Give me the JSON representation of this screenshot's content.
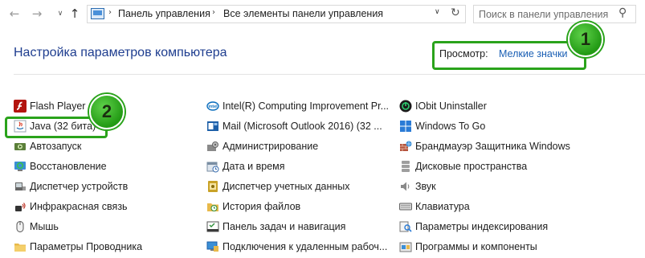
{
  "nav": {
    "back_icon": "arrow-left-icon",
    "forward_icon": "arrow-right-icon",
    "recent_icon": "chevron-down-icon",
    "up_icon": "arrow-up-icon"
  },
  "address": {
    "crumbs": [
      "Панель управления",
      "Все элементы панели управления"
    ],
    "separator": "›",
    "dropdown_glyph": "∨",
    "refresh_glyph": "↻"
  },
  "search": {
    "placeholder": "Поиск в панели управления"
  },
  "header": {
    "title": "Настройка параметров компьютера",
    "view_label": "Просмотр:",
    "view_value": "Мелкие значки"
  },
  "callouts": {
    "first": "1",
    "second": "2"
  },
  "columns": [
    [
      {
        "label": "Flash Player (3",
        "icon": "flash-icon"
      },
      {
        "label": "Java (32 бита)",
        "icon": "java-icon"
      },
      {
        "label": "Автозапуск",
        "icon": "autoplay-icon"
      },
      {
        "label": "Восстановление",
        "icon": "recovery-icon"
      },
      {
        "label": "Диспетчер устройств",
        "icon": "device-manager-icon"
      },
      {
        "label": "Инфракрасная связь",
        "icon": "infrared-icon"
      },
      {
        "label": "Мышь",
        "icon": "mouse-icon"
      },
      {
        "label": "Параметры Проводника",
        "icon": "folder-options-icon"
      }
    ],
    [
      {
        "label": "Intel(R) Computing Improvement Pr...",
        "icon": "intel-icon"
      },
      {
        "label": "Mail (Microsoft Outlook 2016) (32 ...",
        "icon": "mail-icon"
      },
      {
        "label": "Администрирование",
        "icon": "admin-tools-icon"
      },
      {
        "label": "Дата и время",
        "icon": "date-time-icon"
      },
      {
        "label": "Диспетчер учетных данных",
        "icon": "credential-manager-icon"
      },
      {
        "label": "История файлов",
        "icon": "file-history-icon"
      },
      {
        "label": "Панель задач и навигация",
        "icon": "taskbar-icon"
      },
      {
        "label": "Подключения к удаленным рабоч...",
        "icon": "remote-desktop-icon"
      }
    ],
    [
      {
        "label": "IObit Uninstaller",
        "icon": "iobit-icon"
      },
      {
        "label": "Windows To Go",
        "icon": "windows-to-go-icon"
      },
      {
        "label": "Брандмауэр Защитника Windows",
        "icon": "firewall-icon"
      },
      {
        "label": "Дисковые пространства",
        "icon": "storage-spaces-icon"
      },
      {
        "label": "Звук",
        "icon": "sound-icon"
      },
      {
        "label": "Клавиатура",
        "icon": "keyboard-icon"
      },
      {
        "label": "Параметры индексирования",
        "icon": "indexing-icon"
      },
      {
        "label": "Программы и компоненты",
        "icon": "programs-features-icon"
      }
    ]
  ]
}
